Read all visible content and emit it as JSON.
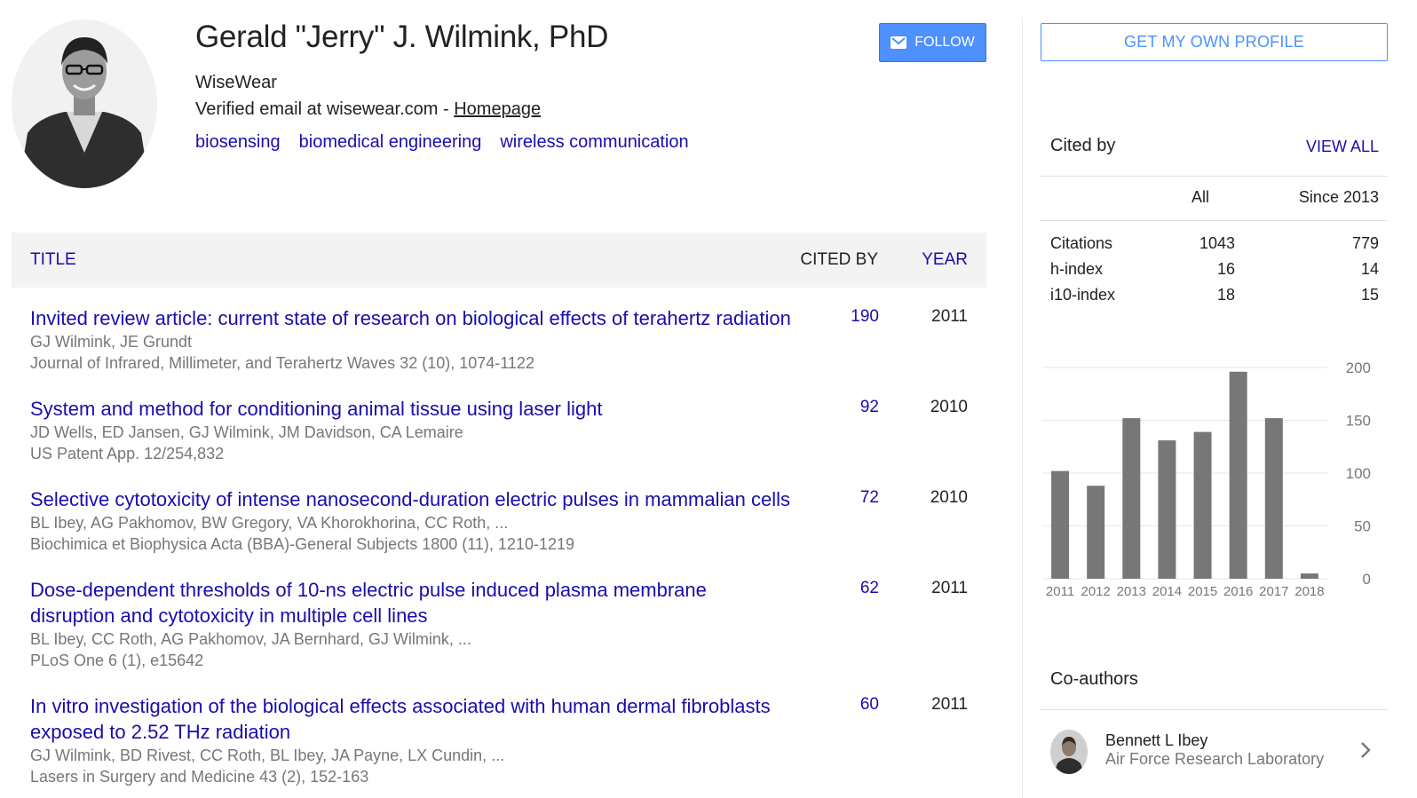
{
  "profile": {
    "name": "Gerald \"Jerry\" J. Wilmink, PhD",
    "affiliation": "WiseWear",
    "verified_text": "Verified email at wisewear.com - ",
    "homepage_label": "Homepage",
    "interests": [
      "biosensing",
      "biomedical engineering",
      "wireless communication"
    ],
    "follow_label": "FOLLOW"
  },
  "table": {
    "col_title": "TITLE",
    "col_cited": "CITED BY",
    "col_year": "YEAR"
  },
  "articles": [
    {
      "title": "Invited review article: current state of research on biological effects of terahertz radiation",
      "authors": "GJ Wilmink, JE Grundt",
      "venue": "Journal of Infrared, Millimeter, and Terahertz Waves 32 (10), 1074-1122",
      "cited_by": "190",
      "year": "2011"
    },
    {
      "title": "System and method for conditioning animal tissue using laser light",
      "authors": "JD Wells, ED Jansen, GJ Wilmink, JM Davidson, CA Lemaire",
      "venue": "US Patent App. 12/254,832",
      "cited_by": "92",
      "year": "2010"
    },
    {
      "title": "Selective cytotoxicity of intense nanosecond-duration electric pulses in mammalian cells",
      "authors": "BL Ibey, AG Pakhomov, BW Gregory, VA Khorokhorina, CC Roth, ...",
      "venue": "Biochimica et Biophysica Acta (BBA)-General Subjects 1800 (11), 1210-1219",
      "cited_by": "72",
      "year": "2010"
    },
    {
      "title": "Dose-dependent thresholds of 10-ns electric pulse induced plasma membrane disruption and cytotoxicity in multiple cell lines",
      "authors": "BL Ibey, CC Roth, AG Pakhomov, JA Bernhard, GJ Wilmink, ...",
      "venue": "PLoS One 6 (1), e15642",
      "cited_by": "62",
      "year": "2011"
    },
    {
      "title": "In vitro investigation of the biological effects associated with human dermal fibroblasts exposed to 2.52 THz radiation",
      "authors": "GJ Wilmink, BD Rivest, CC Roth, BL Ibey, JA Payne, LX Cundin, ...",
      "venue": "Lasers in Surgery and Medicine 43 (2), 152-163",
      "cited_by": "60",
      "year": "2011"
    }
  ],
  "sidebar": {
    "own_profile_label": "GET MY OWN PROFILE",
    "cited_by_heading": "Cited by",
    "view_all_label": "VIEW ALL",
    "stats_header_all": "All",
    "stats_header_since": "Since 2013",
    "stats": [
      {
        "label": "Citations",
        "all": "1043",
        "since": "779"
      },
      {
        "label": "h-index",
        "all": "16",
        "since": "14"
      },
      {
        "label": "i10-index",
        "all": "18",
        "since": "15"
      }
    ],
    "coauthors_heading": "Co-authors",
    "coauthors": [
      {
        "name": "Bennett L Ibey",
        "affiliation": "Air Force Research Laboratory"
      }
    ]
  },
  "chart_data": {
    "type": "bar",
    "categories": [
      "2011",
      "2012",
      "2013",
      "2014",
      "2015",
      "2016",
      "2017",
      "2018"
    ],
    "values": [
      102,
      88,
      152,
      131,
      139,
      196,
      152,
      5
    ],
    "yticks": [
      0,
      50,
      100,
      150,
      200
    ],
    "ylim": [
      0,
      200
    ],
    "bar_color": "#777777",
    "grid": true
  },
  "colors": {
    "link": "#1a0dab",
    "accent": "#4d90fe",
    "muted": "#777777"
  },
  "icons": [
    "mail-icon",
    "chevron-right-icon"
  ]
}
